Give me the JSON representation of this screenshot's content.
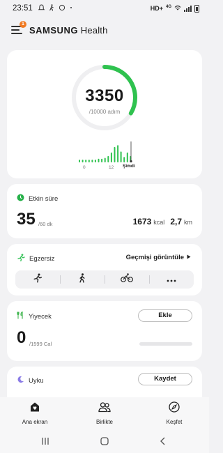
{
  "status_bar": {
    "time": "23:51",
    "right_text": "HD+",
    "network": "4G",
    "icons": [
      "notification-icon",
      "walking-icon",
      "sync-icon",
      "dot-icon",
      "wifi-icon",
      "signal-icon",
      "battery-icon"
    ]
  },
  "header": {
    "brand_bold": "SAMSUNG",
    "brand_light": "Health",
    "menu_badge": "1"
  },
  "steps": {
    "count": "3350",
    "goal": "/10000 adım",
    "progress": 0.335,
    "hourly_bars": [
      0.15,
      0.15,
      0.15,
      0.15,
      0.15,
      0.15,
      0.2,
      0.2,
      0.25,
      0.35,
      0.55,
      0.85,
      0.95,
      0.6,
      0.3,
      0.55,
      0.35
    ],
    "tick_labels": [
      "0",
      "12",
      "Şimdi"
    ],
    "accent": "#2fc24f"
  },
  "active_time": {
    "title": "Etkin süre",
    "minutes": "35",
    "goal": "/60 dk",
    "kcal": "1673",
    "kcal_unit": "kcal",
    "distance": "2,7",
    "distance_unit": "km"
  },
  "exercise": {
    "title": "Egzersiz",
    "history_label": "Geçmişi görüntüle",
    "types": [
      "running-icon",
      "walking-icon",
      "cycling-icon",
      "more-icon"
    ]
  },
  "food": {
    "title": "Yiyecek",
    "add_label": "Ekle",
    "consumed": "0",
    "goal": "/1599 Cal",
    "progress": 0.0
  },
  "sleep": {
    "title": "Uyku",
    "record_label": "Kaydet"
  },
  "bottom_nav": [
    {
      "label": "Ana ekran",
      "icon": "home-icon"
    },
    {
      "label": "Birlikte",
      "icon": "people-icon"
    },
    {
      "label": "Keşfet",
      "icon": "compass-icon"
    }
  ],
  "colors": {
    "green": "#2fc24f",
    "active_green": "#27b14a",
    "exercise_green": "#38c35b",
    "food_green": "#3fb54e",
    "sleep_purple": "#8a7be6",
    "badge_orange": "#f07a22"
  }
}
